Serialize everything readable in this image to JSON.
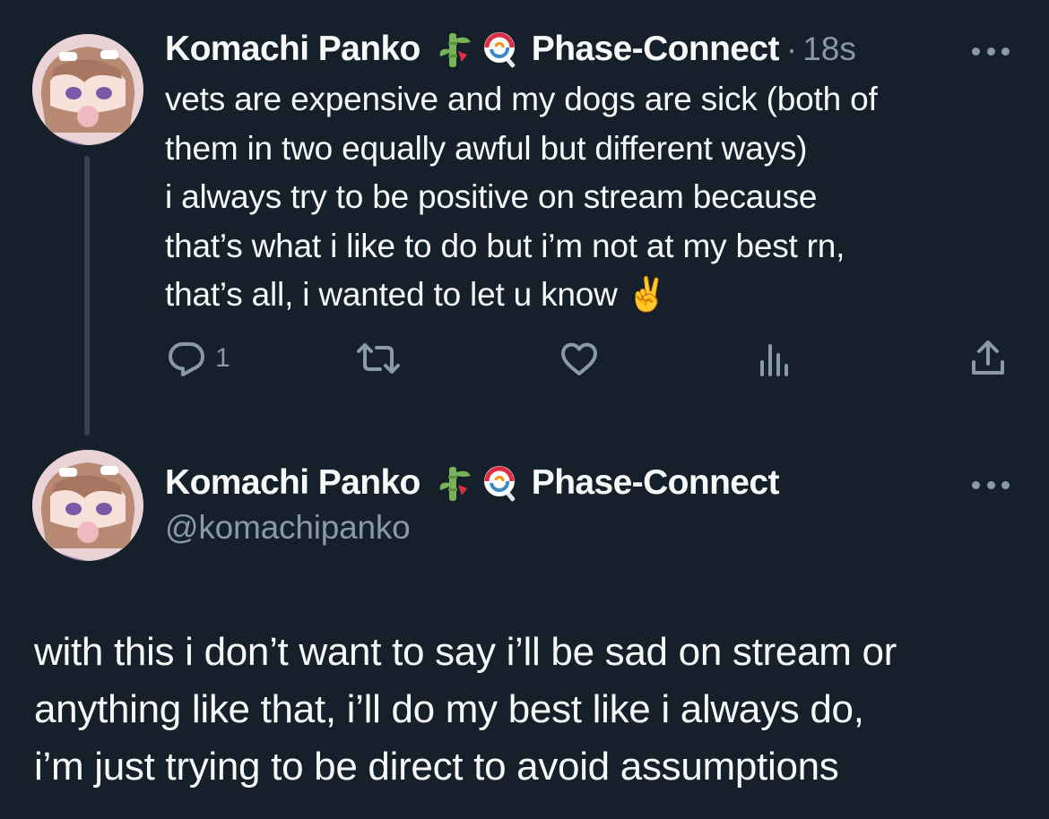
{
  "reply_tweet": {
    "author_name": "Komachi Panko",
    "emoji_icons": [
      "bamboo-icon",
      "lollipop-icon"
    ],
    "group": "Phase-Connect",
    "separator": "·",
    "time": "18s",
    "more_label": "More",
    "text_lines": [
      "vets are expensive and my dogs are sick (both of",
      "them in two equally awful but different ways)",
      "i always try to be positive on stream because",
      "that’s what i like to do but i’m not at my best rn,",
      "that’s all, i wanted to let u know ✌️"
    ],
    "actions": {
      "reply_count": "1",
      "icons": [
        "reply-icon",
        "retweet-icon",
        "like-icon",
        "views-icon",
        "share-icon"
      ]
    }
  },
  "main_tweet": {
    "author_name": "Komachi Panko",
    "emoji_icons": [
      "bamboo-icon",
      "lollipop-icon"
    ],
    "group": "Phase-Connect",
    "handle": "@komachipanko",
    "text_lines": [
      "with this i don’t want to say i’ll be sad on stream or",
      "anything like that, i’ll do my best like i always do,",
      "i’m just trying to be direct to avoid assumptions"
    ]
  },
  "colors": {
    "background": "#15202b",
    "text_primary": "#f7f9f9",
    "text_secondary": "#8b98a5",
    "thread_line": "#38444d"
  }
}
